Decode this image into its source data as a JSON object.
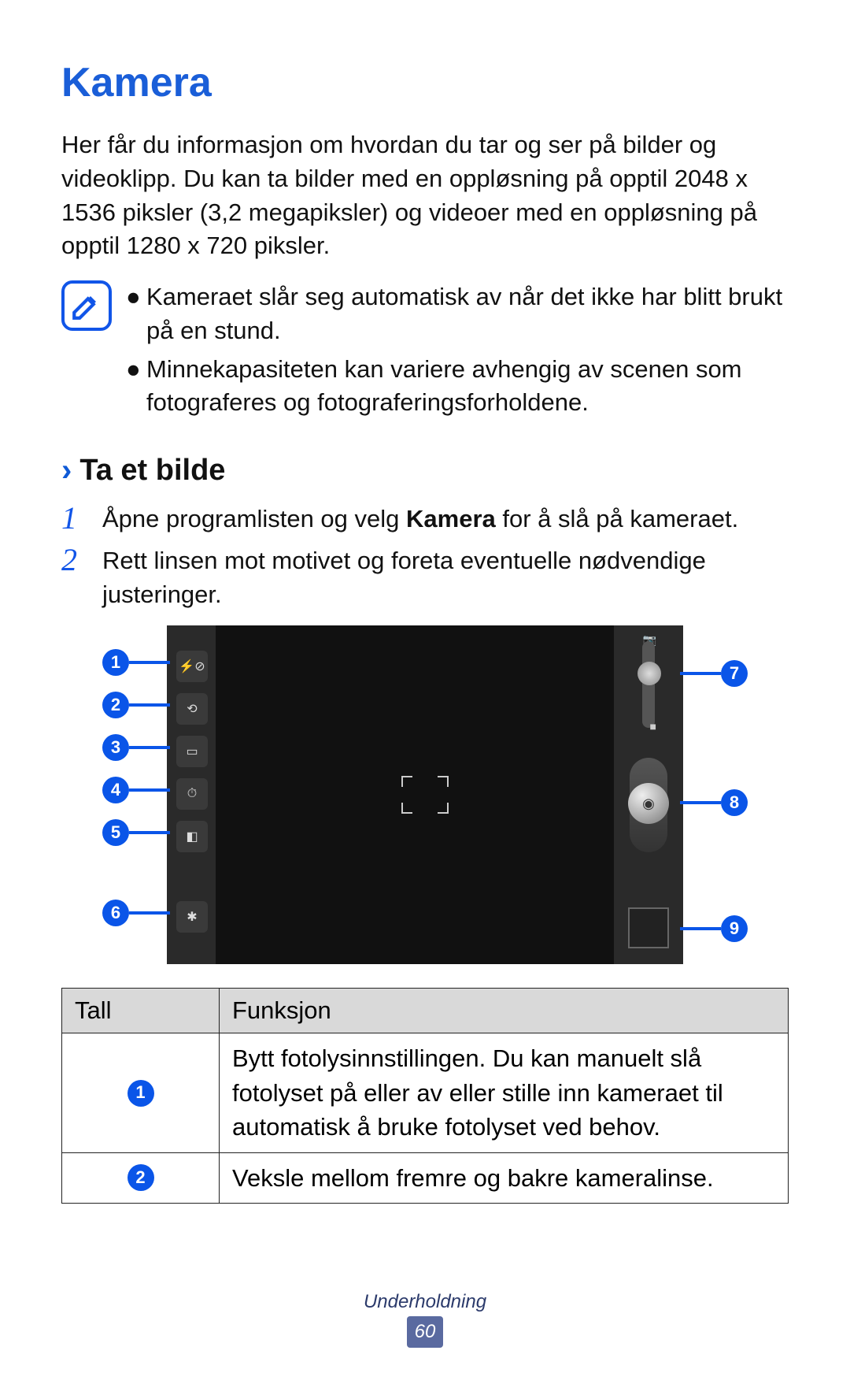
{
  "title": "Kamera",
  "intro": "Her får du informasjon om hvordan du tar og ser på bilder og videoklipp. Du kan ta bilder med en oppløsning på opptil 2048 x 1536 piksler (3,2 megapiksler) og videoer med en oppløsning på opptil 1280 x 720 piksler.",
  "notes": [
    "Kameraet slår seg automatisk av når det ikke har blitt brukt på en stund.",
    "Minnekapasiteten kan variere avhengig av scenen som fotograferes og fotograferingsforholdene."
  ],
  "subhead": "Ta et bilde",
  "steps": {
    "s1_pre": "Åpne programlisten og velg ",
    "s1_bold": "Kamera",
    "s1_post": " for å slå på kameraet.",
    "s2": "Rett linsen mot motivet og foreta eventuelle nødvendige justeringer."
  },
  "callouts": {
    "1": "1",
    "2": "2",
    "3": "3",
    "4": "4",
    "5": "5",
    "6": "6",
    "7": "7",
    "8": "8",
    "9": "9"
  },
  "table": {
    "head_num": "Tall",
    "head_func": "Funksjon",
    "rows": [
      {
        "n": "1",
        "text": "Bytt fotolysinnstillingen. Du kan manuelt slå fotolyset på eller av eller stille inn kameraet til automatisk å bruke fotolyset ved behov."
      },
      {
        "n": "2",
        "text": "Veksle mellom fremre og bakre kameralinse."
      }
    ]
  },
  "footer": {
    "section": "Underholdning",
    "page": "60"
  }
}
